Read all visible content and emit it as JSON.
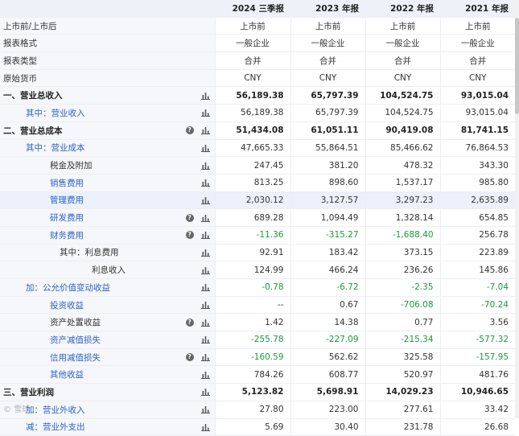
{
  "columns": [
    "2024 三季报",
    "2023 年报",
    "2022 年报",
    "2021 年报"
  ],
  "rows": [
    {
      "label": "上市前/上市后",
      "indent": 0,
      "vals": [
        "上市前",
        "上市前",
        "上市前",
        "上市前"
      ],
      "center": true
    },
    {
      "label": "报表格式",
      "indent": 0,
      "vals": [
        "一般企业",
        "一般企业",
        "一般企业",
        "一般企业"
      ],
      "center": true
    },
    {
      "label": "报表类型",
      "indent": 0,
      "vals": [
        "合并",
        "合并",
        "合并",
        "合并"
      ],
      "center": true
    },
    {
      "label": "原始货币",
      "indent": 0,
      "vals": [
        "CNY",
        "CNY",
        "CNY",
        "CNY"
      ],
      "center": true
    },
    {
      "label": "一、营业总收入",
      "indent": 0,
      "bold": true,
      "bar": true,
      "vals": [
        "56,189.38",
        "65,797.39",
        "104,524.75",
        "93,015.04"
      ]
    },
    {
      "label": "其中：营业收入",
      "indent": 1,
      "blue": true,
      "bar": true,
      "vals": [
        "56,189.38",
        "65,797.39",
        "104,524.75",
        "93,015.04"
      ]
    },
    {
      "label": "二、营业总成本",
      "indent": 0,
      "bold": true,
      "q": true,
      "bar": true,
      "vals": [
        "51,434.08",
        "61,051.11",
        "90,419.08",
        "81,741.15"
      ]
    },
    {
      "label": "其中：营业成本",
      "indent": 1,
      "blue": true,
      "bar": true,
      "vals": [
        "47,665.33",
        "55,864.51",
        "85,466.62",
        "76,864.53"
      ]
    },
    {
      "label": "税金及附加",
      "indent": 2,
      "bar": true,
      "vals": [
        "247.45",
        "381.20",
        "478.32",
        "343.30"
      ]
    },
    {
      "label": "销售费用",
      "indent": 2,
      "blue": true,
      "bar": true,
      "vals": [
        "813.25",
        "898.60",
        "1,537.17",
        "985.80"
      ]
    },
    {
      "label": "管理费用",
      "indent": 2,
      "blue": true,
      "bar": true,
      "hl": true,
      "vals": [
        "2,030.12",
        "3,127.57",
        "3,297.23",
        "2,635.89"
      ]
    },
    {
      "label": "研发费用",
      "indent": 2,
      "blue": true,
      "q": true,
      "bar": true,
      "vals": [
        "689.28",
        "1,094.49",
        "1,328.14",
        "654.85"
      ]
    },
    {
      "label": "财务费用",
      "indent": 2,
      "blue": true,
      "q": true,
      "bar": true,
      "vals": [
        "-11.36",
        "-315.27",
        "-1,688.40",
        "256.78"
      ]
    },
    {
      "label": "其中：利息费用",
      "indent": 3,
      "bar": true,
      "vals": [
        "92.91",
        "183.42",
        "373.15",
        "223.89"
      ]
    },
    {
      "label": "利息收入",
      "indent": 4,
      "bar": true,
      "vals": [
        "124.99",
        "466.24",
        "236.26",
        "145.86"
      ]
    },
    {
      "label": "加：公允价值变动收益",
      "indent": 1,
      "blue": true,
      "bar": true,
      "vals": [
        "-0.78",
        "-6.72",
        "-2.35",
        "-7.04"
      ]
    },
    {
      "label": "投资收益",
      "indent": 2,
      "blue": true,
      "bar": true,
      "vals": [
        "--",
        "0.67",
        "-706.08",
        "-70.24"
      ]
    },
    {
      "label": "资产处置收益",
      "indent": 2,
      "q": true,
      "bar": true,
      "vals": [
        "1.42",
        "14.38",
        "0.77",
        "3.56"
      ]
    },
    {
      "label": "资产减值损失",
      "indent": 2,
      "blue": true,
      "bar": true,
      "vals": [
        "-255.78",
        "-227.09",
        "-215.34",
        "-577.32"
      ]
    },
    {
      "label": "信用减值损失",
      "indent": 2,
      "blue": true,
      "q": true,
      "bar": true,
      "vals": [
        "-160.59",
        "562.62",
        "325.58",
        "-157.95"
      ]
    },
    {
      "label": "其他收益",
      "indent": 2,
      "blue": true,
      "bar": true,
      "vals": [
        "784.26",
        "608.77",
        "520.97",
        "481.76"
      ]
    },
    {
      "label": "三、营业利润",
      "indent": 0,
      "bold": true,
      "bar": true,
      "vals": [
        "5,123.82",
        "5,698.91",
        "14,029.23",
        "10,946.65"
      ]
    },
    {
      "label": "加：营业外收入",
      "indent": 1,
      "blue": true,
      "bar": true,
      "vals": [
        "27.80",
        "223.00",
        "277.61",
        "33.42"
      ]
    },
    {
      "label": "减：营业外支出",
      "indent": 1,
      "blue": true,
      "bar": true,
      "vals": [
        "5.69",
        "30.40",
        "231.78",
        "26.68"
      ]
    }
  ],
  "icons": {
    "help": "question-circle-icon",
    "chart": "bar-chart-icon"
  },
  "colors": {
    "link": "#2a62c9",
    "negative": "#1a9a3a",
    "header_bg": "#eef1f8",
    "highlight": "#eaf1fb"
  },
  "watermark": "© 雪球"
}
